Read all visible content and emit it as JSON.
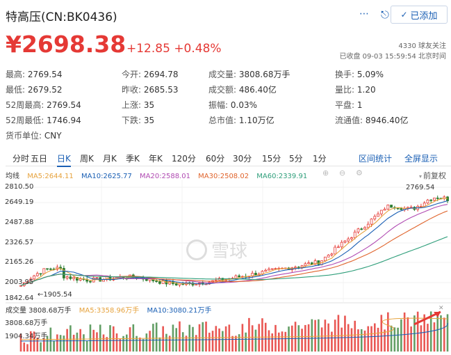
{
  "header": {
    "title": "特高压(CN:BK0436)",
    "more_icon": "⋯",
    "share_icon": "share-icon",
    "add_button_label": "已添加"
  },
  "quote": {
    "price": "¥2698.38",
    "change": "+12.85 +0.48%",
    "followers": "4330 球友关注",
    "status": "已收盘 09-03 15:59:54 北京时间"
  },
  "stats": {
    "high": {
      "label": "最高:",
      "value": "2769.54"
    },
    "low": {
      "label": "最低:",
      "value": "2679.52"
    },
    "w52_high": {
      "label": "52周最高:",
      "value": "2769.54"
    },
    "w52_low": {
      "label": "52周最低:",
      "value": "1746.94"
    },
    "currency": {
      "label": "货币单位:",
      "value": "CNY"
    },
    "open": {
      "label": "今开:",
      "value": "2694.78"
    },
    "prev_close": {
      "label": "昨收:",
      "value": "2685.53"
    },
    "up": {
      "label": "上涨:",
      "value": "35"
    },
    "down": {
      "label": "下跌:",
      "value": "35"
    },
    "volume": {
      "label": "成交量:",
      "value": "3808.68万手"
    },
    "amount": {
      "label": "成交额:",
      "value": "486.40亿"
    },
    "amplitude": {
      "label": "振幅:",
      "value": "0.03%"
    },
    "mkt_cap": {
      "label": "总市值:",
      "value": "1.10万亿"
    },
    "turnover": {
      "label": "换手:",
      "value": "5.09%"
    },
    "vol_ratio": {
      "label": "量比:",
      "value": "1.20"
    },
    "flat": {
      "label": "平盘:",
      "value": "1"
    },
    "float_cap": {
      "label": "流通值:",
      "value": "8946.40亿"
    }
  },
  "tabs": [
    "分时",
    "五日",
    "日K",
    "周K",
    "月K",
    "季K",
    "年K",
    "120分",
    "60分",
    "30分",
    "15分",
    "5分",
    "1分"
  ],
  "active_tab": "日K",
  "tab_right": [
    "区间统计",
    "全屏显示"
  ],
  "ma_legend": {
    "label": "均线",
    "ma5": "MA5:2644.11",
    "ma10": "MA10:2625.77",
    "ma20": "MA20:2588.01",
    "ma30": "MA30:2508.02",
    "ma60": "MA60:2339.91"
  },
  "adjust": "前复权",
  "chart_data": {
    "type": "candlestick",
    "y_ticks": [
      "2810.50",
      "2649.19",
      "2487.88",
      "2326.57",
      "2165.26",
      "2003.95",
      "1842.64"
    ],
    "ylim": [
      1800,
      2850
    ],
    "high_label": "2769.54",
    "low_label": "1905.54",
    "watermark": "雪球",
    "colors": {
      "up": "#e53935",
      "down": "#2e7d32",
      "ma5": "#e6a23c",
      "ma10": "#1a5fb4",
      "ma20": "#b04ab2",
      "ma30": "#e0642c",
      "ma60": "#2e9e7a"
    },
    "volume_legend": {
      "label": "成交量 3808.68万手",
      "ma5": "MA5:3358.96万手",
      "ma10": "MA10:3080.21万手"
    },
    "volume_ticks": [
      "3808.68万手",
      "1904.34万手"
    ]
  }
}
